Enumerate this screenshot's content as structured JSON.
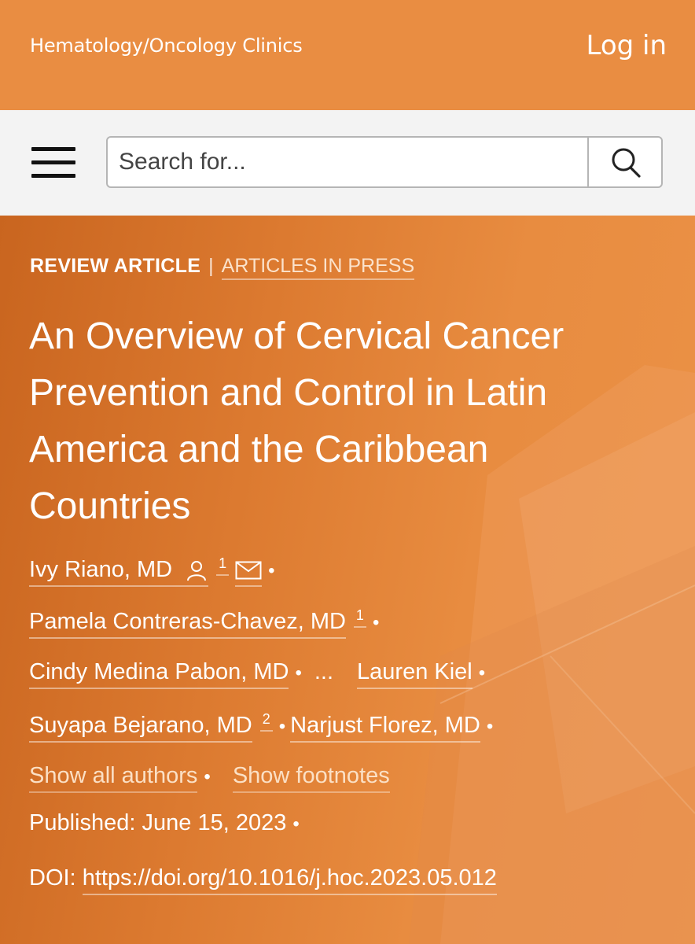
{
  "header": {
    "journal_name": "Hematology/Oncology Clinics",
    "login_label": "Log in",
    "background_color": "#e98d42"
  },
  "search": {
    "placeholder": "Search for...",
    "menu_icon": "hamburger-menu-icon",
    "search_icon": "magnifier-icon"
  },
  "article": {
    "type": "REVIEW ARTICLE",
    "separator": "|",
    "section": "ARTICLES IN PRESS",
    "title": "An Overview of Cervical Cancer Prevention and Control in Latin America and the Caribbean Countries",
    "authors": [
      {
        "name": "Ivy Riano, MD",
        "sup": "1",
        "icons": [
          "person-icon",
          "envelope-icon"
        ]
      },
      {
        "name": "Pamela Contreras-Chavez, MD",
        "sup": "1"
      },
      {
        "name": "Cindy Medina Pabon, MD",
        "sup": ""
      },
      {
        "name": "Lauren Kiel",
        "sup": ""
      },
      {
        "name": "Suyapa Bejarano, MD",
        "sup": "2"
      },
      {
        "name": "Narjust Florez, MD",
        "sup": ""
      }
    ],
    "ellipsis": "...",
    "bullet": "•",
    "show_all_authors": "Show all authors",
    "show_footnotes": "Show footnotes",
    "published_label": "Published:",
    "published_date": "June 15, 2023",
    "doi_label": "DOI:",
    "doi": "https://doi.org/10.1016/j.hoc.2023.05.012"
  }
}
